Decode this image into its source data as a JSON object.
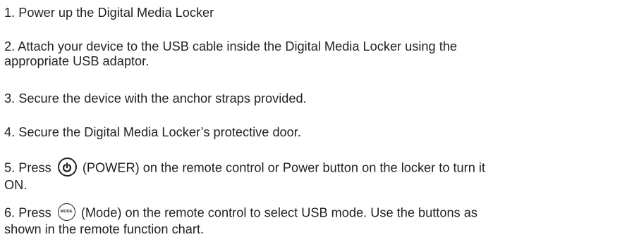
{
  "steps": [
    {
      "text": "1. Power up the Digital Media Locker"
    },
    {
      "line1": "2. Attach your device to the USB cable inside the Digital Media Locker using the",
      "line2": "appropriate USB adaptor."
    },
    {
      "text": "3. Secure the device with the anchor straps provided."
    },
    {
      "text": "4. Secure the Digital Media Locker’s protective door."
    },
    {
      "before": "5. Press",
      "after": "(POWER) on the remote control or Power button on the locker to turn it",
      "line2": "ON."
    },
    {
      "before": "6. Press",
      "icon_label": "MODE",
      "after": "(Mode) on the remote control to select USB mode. Use the buttons as",
      "line2": "shown in the remote function chart."
    }
  ]
}
